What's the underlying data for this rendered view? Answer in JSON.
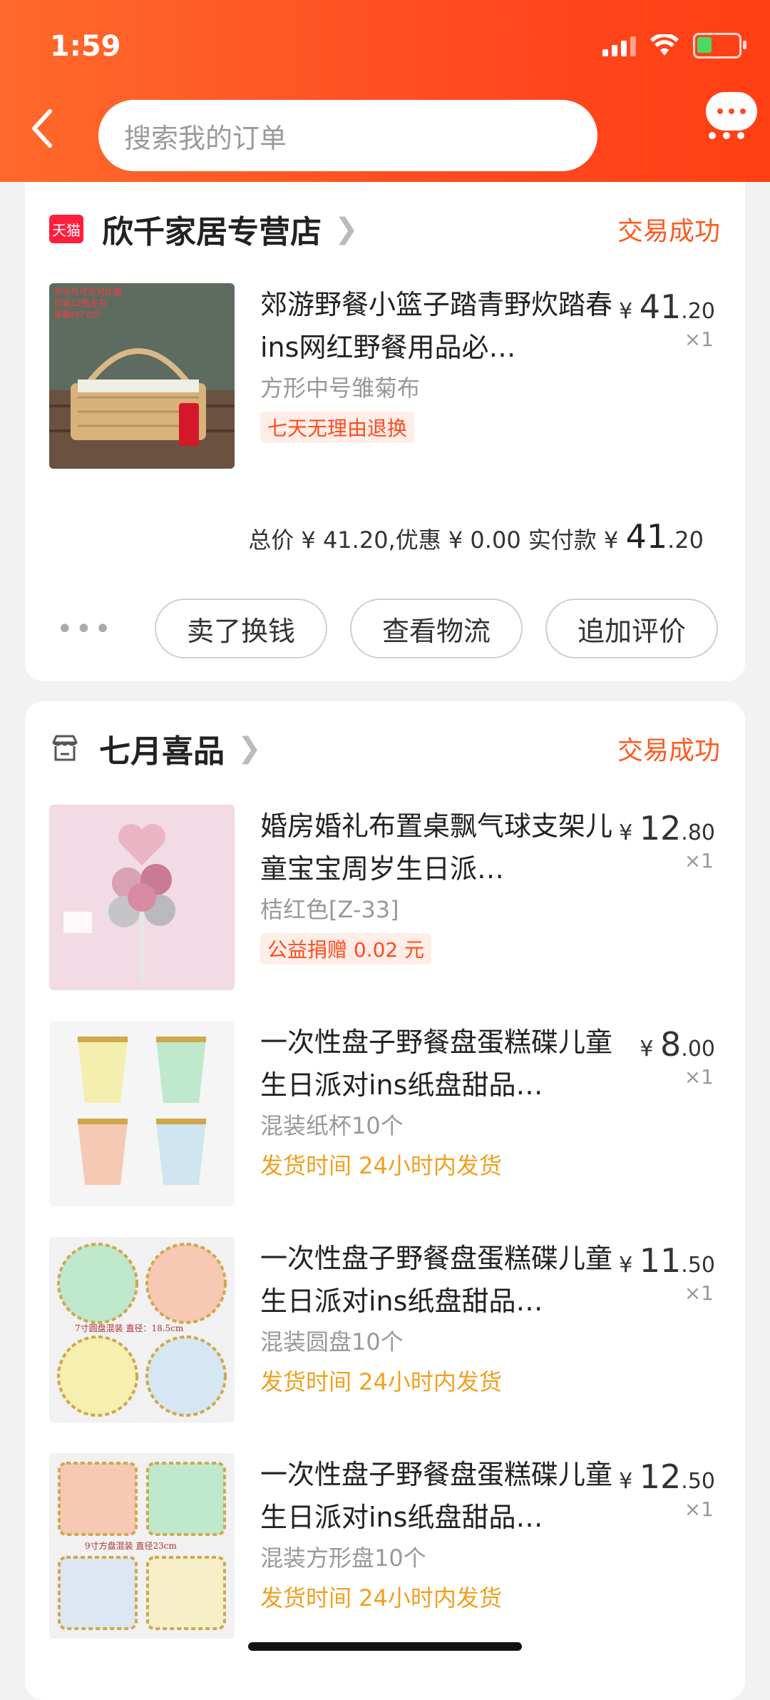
{
  "status_bar": {
    "time": "1:59"
  },
  "header": {
    "search_placeholder": "搜索我的订单"
  },
  "orders": [
    {
      "shop_name": "欣千家居专营店",
      "shop_badge": "天猫",
      "status": "交易成功",
      "items": [
        {
          "title": "郊游野餐小篮子踏青野炊踏春ins网红野餐用品必…",
          "price_prefix": "¥ ",
          "price_int": "41",
          "price_dec": ".20",
          "qty": "×1",
          "sku": "方形中号雏菊布",
          "tag": "七天无理由退换",
          "thumb_text": "中号与可乐对比图\n可装12瓶左右\n承重约7公斤"
        }
      ],
      "summary": {
        "text": "总价 ¥ 41.20,优惠 ¥ 0.00 实付款 ¥ ",
        "paid_int": "41",
        "paid_dec": ".20"
      },
      "actions": [
        "卖了换钱",
        "查看物流",
        "追加评价"
      ],
      "more": "•••"
    },
    {
      "shop_name": "七月喜品",
      "status": "交易成功",
      "items": [
        {
          "title": "婚房婚礼布置桌飘气球支架儿童宝宝周岁生日派…",
          "price_prefix": "¥ ",
          "price_int": "12",
          "price_dec": ".80",
          "qty": "×1",
          "sku": "桔红色[Z-33]",
          "tag": "公益捐赠 0.02 元"
        },
        {
          "title": "一次性盘子野餐盘蛋糕碟儿童生日派对ins纸盘甜品…",
          "price_prefix": "¥ ",
          "price_int": "8",
          "price_dec": ".00",
          "qty": "×1",
          "sku": "混装纸杯10个",
          "ship": "发货时间  24小时内发货"
        },
        {
          "title": "一次性盘子野餐盘蛋糕碟儿童生日派对ins纸盘甜品…",
          "price_prefix": "¥ ",
          "price_int": "11",
          "price_dec": ".50",
          "qty": "×1",
          "sku": "混装圆盘10个",
          "ship": "发货时间  24小时内发货",
          "thumb_text": "7寸圆盘混装  直径：18.5cm"
        },
        {
          "title": "一次性盘子野餐盘蛋糕碟儿童生日派对ins纸盘甜品…",
          "price_prefix": "¥ ",
          "price_int": "12",
          "price_dec": ".50",
          "qty": "×1",
          "sku": "混装方形盘10个",
          "ship": "发货时间  24小时内发货",
          "thumb_text": "9寸方盘混装  直径23cm"
        }
      ]
    }
  ],
  "colors": {
    "accent": "#ff4a1f",
    "ship": "#f0a020",
    "tmall": "#ff1e3c"
  }
}
